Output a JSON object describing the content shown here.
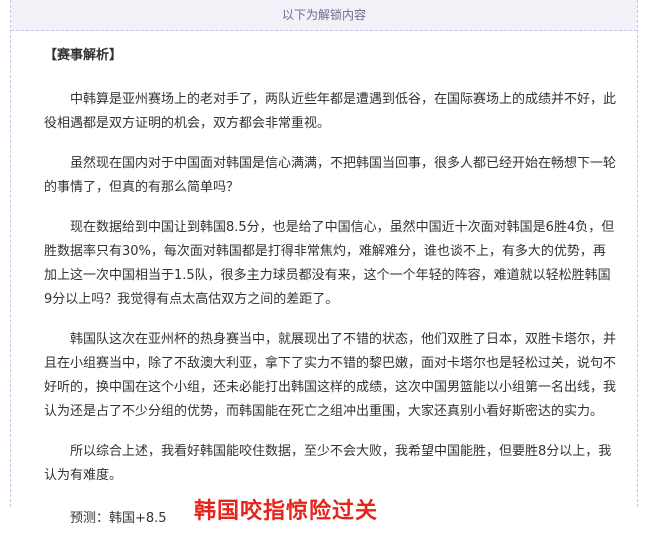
{
  "unlock_banner": "以下为解锁内容",
  "section_title": "【赛事解析】",
  "paragraphs": [
    "中韩算是亚州赛场上的老对手了，两队近些年都是遭遇到低谷，在国际赛场上的成绩并不好，此役相遇都是双方证明的机会，双方都会非常重视。",
    "虽然现在国内对于中国面对韩国是信心满满，不把韩国当回事，很多人都已经开始在畅想下一轮的事情了，但真的有那么简单吗？",
    "现在数据给到中国让到韩国8.5分，也是给了中国信心，虽然中国近十次面对韩国是6胜4负，但胜数据率只有30%，每次面对韩国都是打得非常焦灼，难解难分，谁也谈不上，有多大的优势，再加上这一次中国相当于1.5队，很多主力球员都没有来，这个一个年轻的阵容，难道就以轻松胜韩国9分以上吗？我觉得有点太高估双方之间的差距了。",
    "韩国队这次在亚州杯的热身赛当中，就展现出了不错的状态，他们双胜了日本，双胜卡塔尔，并且在小组赛当中，除了不敌澳大利亚，拿下了实力不错的黎巴嫩，面对卡塔尔也是轻松过关，说句不好听的，换中国在这个小组，还未必能打出韩国这样的成绩，这次中国男篮能以小组第一名出线，我认为还是占了不少分组的优势，而韩国能在死亡之组冲出重围，大家还真别小看好斯密达的实力。",
    "所以综合上述，我看好韩国能咬住数据，至少不会大败，我希望中国能胜，但要胜8分以上，我认为有难度。"
  ],
  "prediction": "预测：韩国+8.5",
  "headline": "韩国咬指惊险过关",
  "colors": {
    "headline": "#e8231a",
    "banner_bg": "#f1f1f7",
    "border": "#c9c4e6"
  }
}
